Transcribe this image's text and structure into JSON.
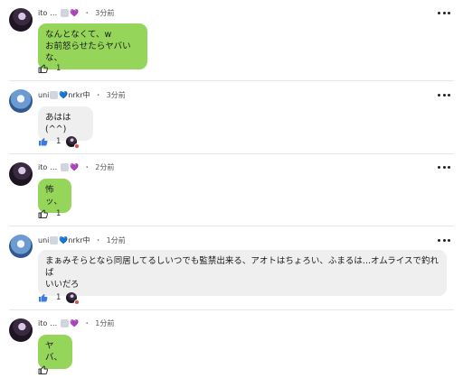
{
  "comments": [
    {
      "user": "ito",
      "name": "ito",
      "name_suffix": "…",
      "heart": "💜",
      "time": "3分前",
      "text": "なんとなくて、w\nお前怒らせたらヤバいな、",
      "bubble_color": "#95d65a",
      "like_count": "1",
      "liked": false,
      "reactor_avatar": false
    },
    {
      "user": "uni",
      "name": "uni",
      "heart": "💙",
      "name_suffix": "nrkr中",
      "time": "3分前",
      "text": "あはは (^^)",
      "bubble_color": "#efefef",
      "like_count": "1",
      "liked": true,
      "reactor_avatar": true
    },
    {
      "user": "ito",
      "name": "ito",
      "name_suffix": "…",
      "heart": "💜",
      "time": "2分前",
      "text": "怖ッ、",
      "bubble_color": "#95d65a",
      "like_count": "1",
      "liked": false,
      "reactor_avatar": false
    },
    {
      "user": "uni",
      "name": "uni",
      "heart": "💙",
      "name_suffix": "nrkr中",
      "time": "1分前",
      "text": "まぁみそらとなら同居してるしいつでも監禁出来る、アオトはちょろい、ふまるは...オムライスで釣れば\nいいだろ",
      "bubble_color": "#efefef",
      "like_count": "1",
      "liked": true,
      "reactor_avatar": true
    },
    {
      "user": "ito",
      "name": "ito",
      "name_suffix": "…",
      "heart": "💜",
      "time": "1分前",
      "text": "ヤバ、",
      "bubble_color": "#95d65a",
      "like_count": "",
      "liked": false,
      "reactor_avatar": false
    }
  ],
  "meta": {
    "separator": "・"
  },
  "icons": {
    "more": "more-options-icon",
    "like": "thumbs-up-icon",
    "like_filled": "thumbs-up-filled-icon"
  },
  "colors": {
    "like_active": "#3a7be0",
    "green_bubble": "#95d65a",
    "gray_bubble": "#efefef"
  }
}
